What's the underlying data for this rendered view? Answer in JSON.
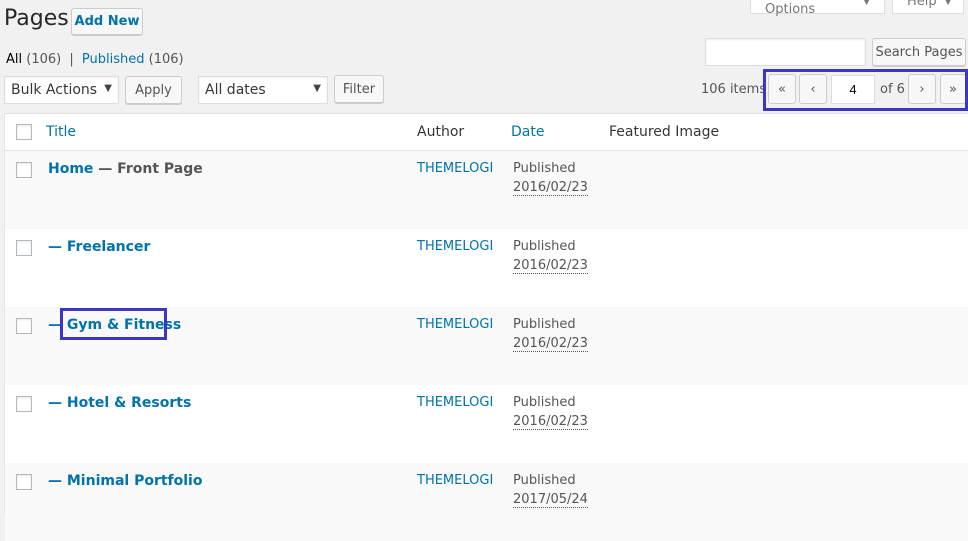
{
  "header": {
    "title": "Pages",
    "add_new_label": "Add New",
    "screen_options_label": "Screen Options",
    "help_label": "Help"
  },
  "views": {
    "all_label": "All",
    "all_count": "(106)",
    "separator": "|",
    "published_label": "Published",
    "published_count": "(106)"
  },
  "search": {
    "placeholder": "",
    "button_label": "Search Pages"
  },
  "filters": {
    "bulk_actions": "Bulk Actions",
    "apply_label": "Apply",
    "dates": "All dates",
    "filter_label": "Filter"
  },
  "pagination": {
    "items_count": "106 items",
    "first": "«",
    "prev": "‹",
    "current_page": "4",
    "of_pages": "of 6",
    "next": "›",
    "last": "»"
  },
  "table": {
    "columns": {
      "title": "Title",
      "author": "Author",
      "date": "Date",
      "featured_image": "Featured Image"
    },
    "rows": [
      {
        "title": "Home",
        "suffix": " — Front Page",
        "author": "THEMELOGI",
        "status": "Published",
        "date": "2016/02/23"
      },
      {
        "title": "— Freelancer",
        "suffix": "",
        "author": "THEMELOGI",
        "status": "Published",
        "date": "2016/02/23"
      },
      {
        "title": "— Gym & Fitness",
        "suffix": "",
        "author": "THEMELOGI",
        "status": "Published",
        "date": "2016/02/23"
      },
      {
        "title": "— Hotel & Resorts",
        "suffix": "",
        "author": "THEMELOGI",
        "status": "Published",
        "date": "2016/02/23"
      },
      {
        "title": "— Minimal Portfolio",
        "suffix": "",
        "author": "THEMELOGI",
        "status": "Published",
        "date": "2017/05/24"
      }
    ]
  },
  "colors": {
    "link": "#0073aa",
    "highlight": "#3b37c4",
    "background": "#f1f1f1"
  }
}
